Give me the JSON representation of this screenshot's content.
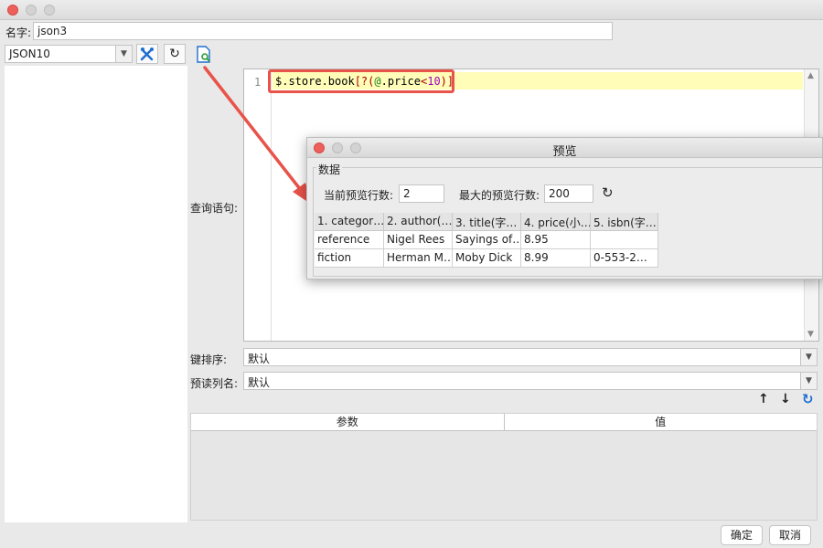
{
  "window": {
    "title": ""
  },
  "name": {
    "label": "名字:",
    "value": "json3"
  },
  "connection": {
    "selected": "JSON10"
  },
  "query": {
    "label": "查询语句:",
    "line_number": "1",
    "code_prefix": "$.store.book",
    "code_bracket_open": "[?(",
    "code_at": "@",
    "code_field": ".price",
    "code_op": "<",
    "code_num": "10",
    "code_bracket_close": ")]"
  },
  "preview": {
    "title": "预览",
    "group_label": "数据",
    "current_rows_label": "当前预览行数:",
    "current_rows_value": "2",
    "max_rows_label": "最大的预览行数:",
    "max_rows_value": "200",
    "columns": [
      "1. categor…",
      "2. author(…",
      "3. title(字…",
      "4. price(小…",
      "5. isbn(字…"
    ],
    "rows": [
      [
        "reference",
        "Nigel Rees",
        "Sayings of…",
        "8.95",
        ""
      ],
      [
        "fiction",
        "Herman M…",
        "Moby Dick",
        "8.99",
        "0-553-2…"
      ]
    ]
  },
  "key_sort": {
    "label": "键排序:",
    "value": "默认"
  },
  "preread": {
    "label": "预读列名:",
    "value": "默认"
  },
  "params_table": {
    "col_param": "参数",
    "col_value": "值"
  },
  "buttons": {
    "ok": "确定",
    "cancel": "取消"
  },
  "colors": {
    "highlight_box": "#e8534a",
    "line_highlight": "#fffdb8",
    "accent": "#1f6fd1"
  }
}
